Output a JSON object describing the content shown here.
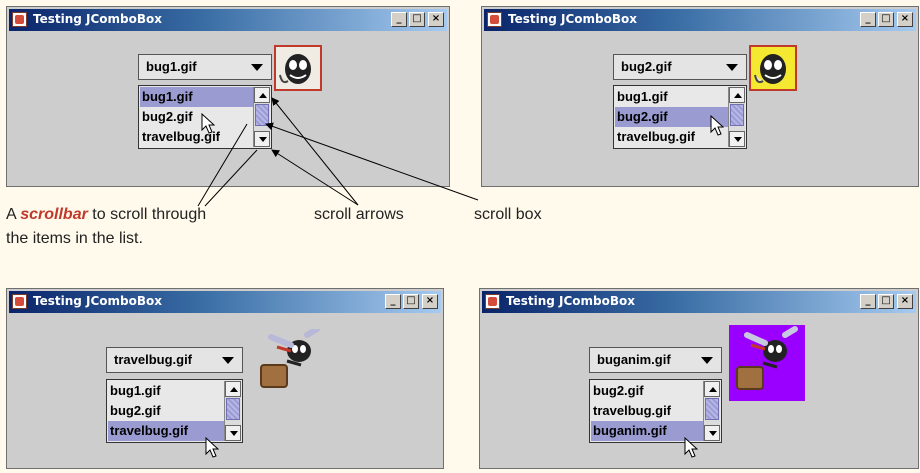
{
  "windows": [
    {
      "title": "Testing JComboBox",
      "combo_value": "bug1.gif",
      "items": [
        "bug1.gif",
        "bug2.gif",
        "travelbug.gif"
      ],
      "selected_index": 0
    },
    {
      "title": "Testing JComboBox",
      "combo_value": "bug2.gif",
      "items": [
        "bug1.gif",
        "bug2.gif",
        "travelbug.gif"
      ],
      "selected_index": 1
    },
    {
      "title": "Testing JComboBox",
      "combo_value": "travelbug.gif",
      "items": [
        "bug1.gif",
        "bug2.gif",
        "travelbug.gif"
      ],
      "selected_index": 2
    },
    {
      "title": "Testing JComboBox",
      "combo_value": "buganim.gif",
      "items": [
        "bug2.gif",
        "travelbug.gif",
        "buganim.gif"
      ],
      "selected_index": 2
    }
  ],
  "title_buttons": {
    "minimize": "_",
    "maximize": "□",
    "close": "×"
  },
  "annotations": {
    "scrollbar_prefix": "A ",
    "scrollbar_emph": "scrollbar",
    "scrollbar_rest": " to scroll through",
    "scrollbar_line2": "the items in the list.",
    "scroll_arrows": "scroll arrows",
    "scroll_box": "scroll box"
  },
  "icons": [
    "window-icon",
    "minimize-icon",
    "maximize-icon",
    "close-icon",
    "dropdown-arrow-icon",
    "scroll-up-icon",
    "scroll-down-icon",
    "mouse-pointer-icon"
  ]
}
